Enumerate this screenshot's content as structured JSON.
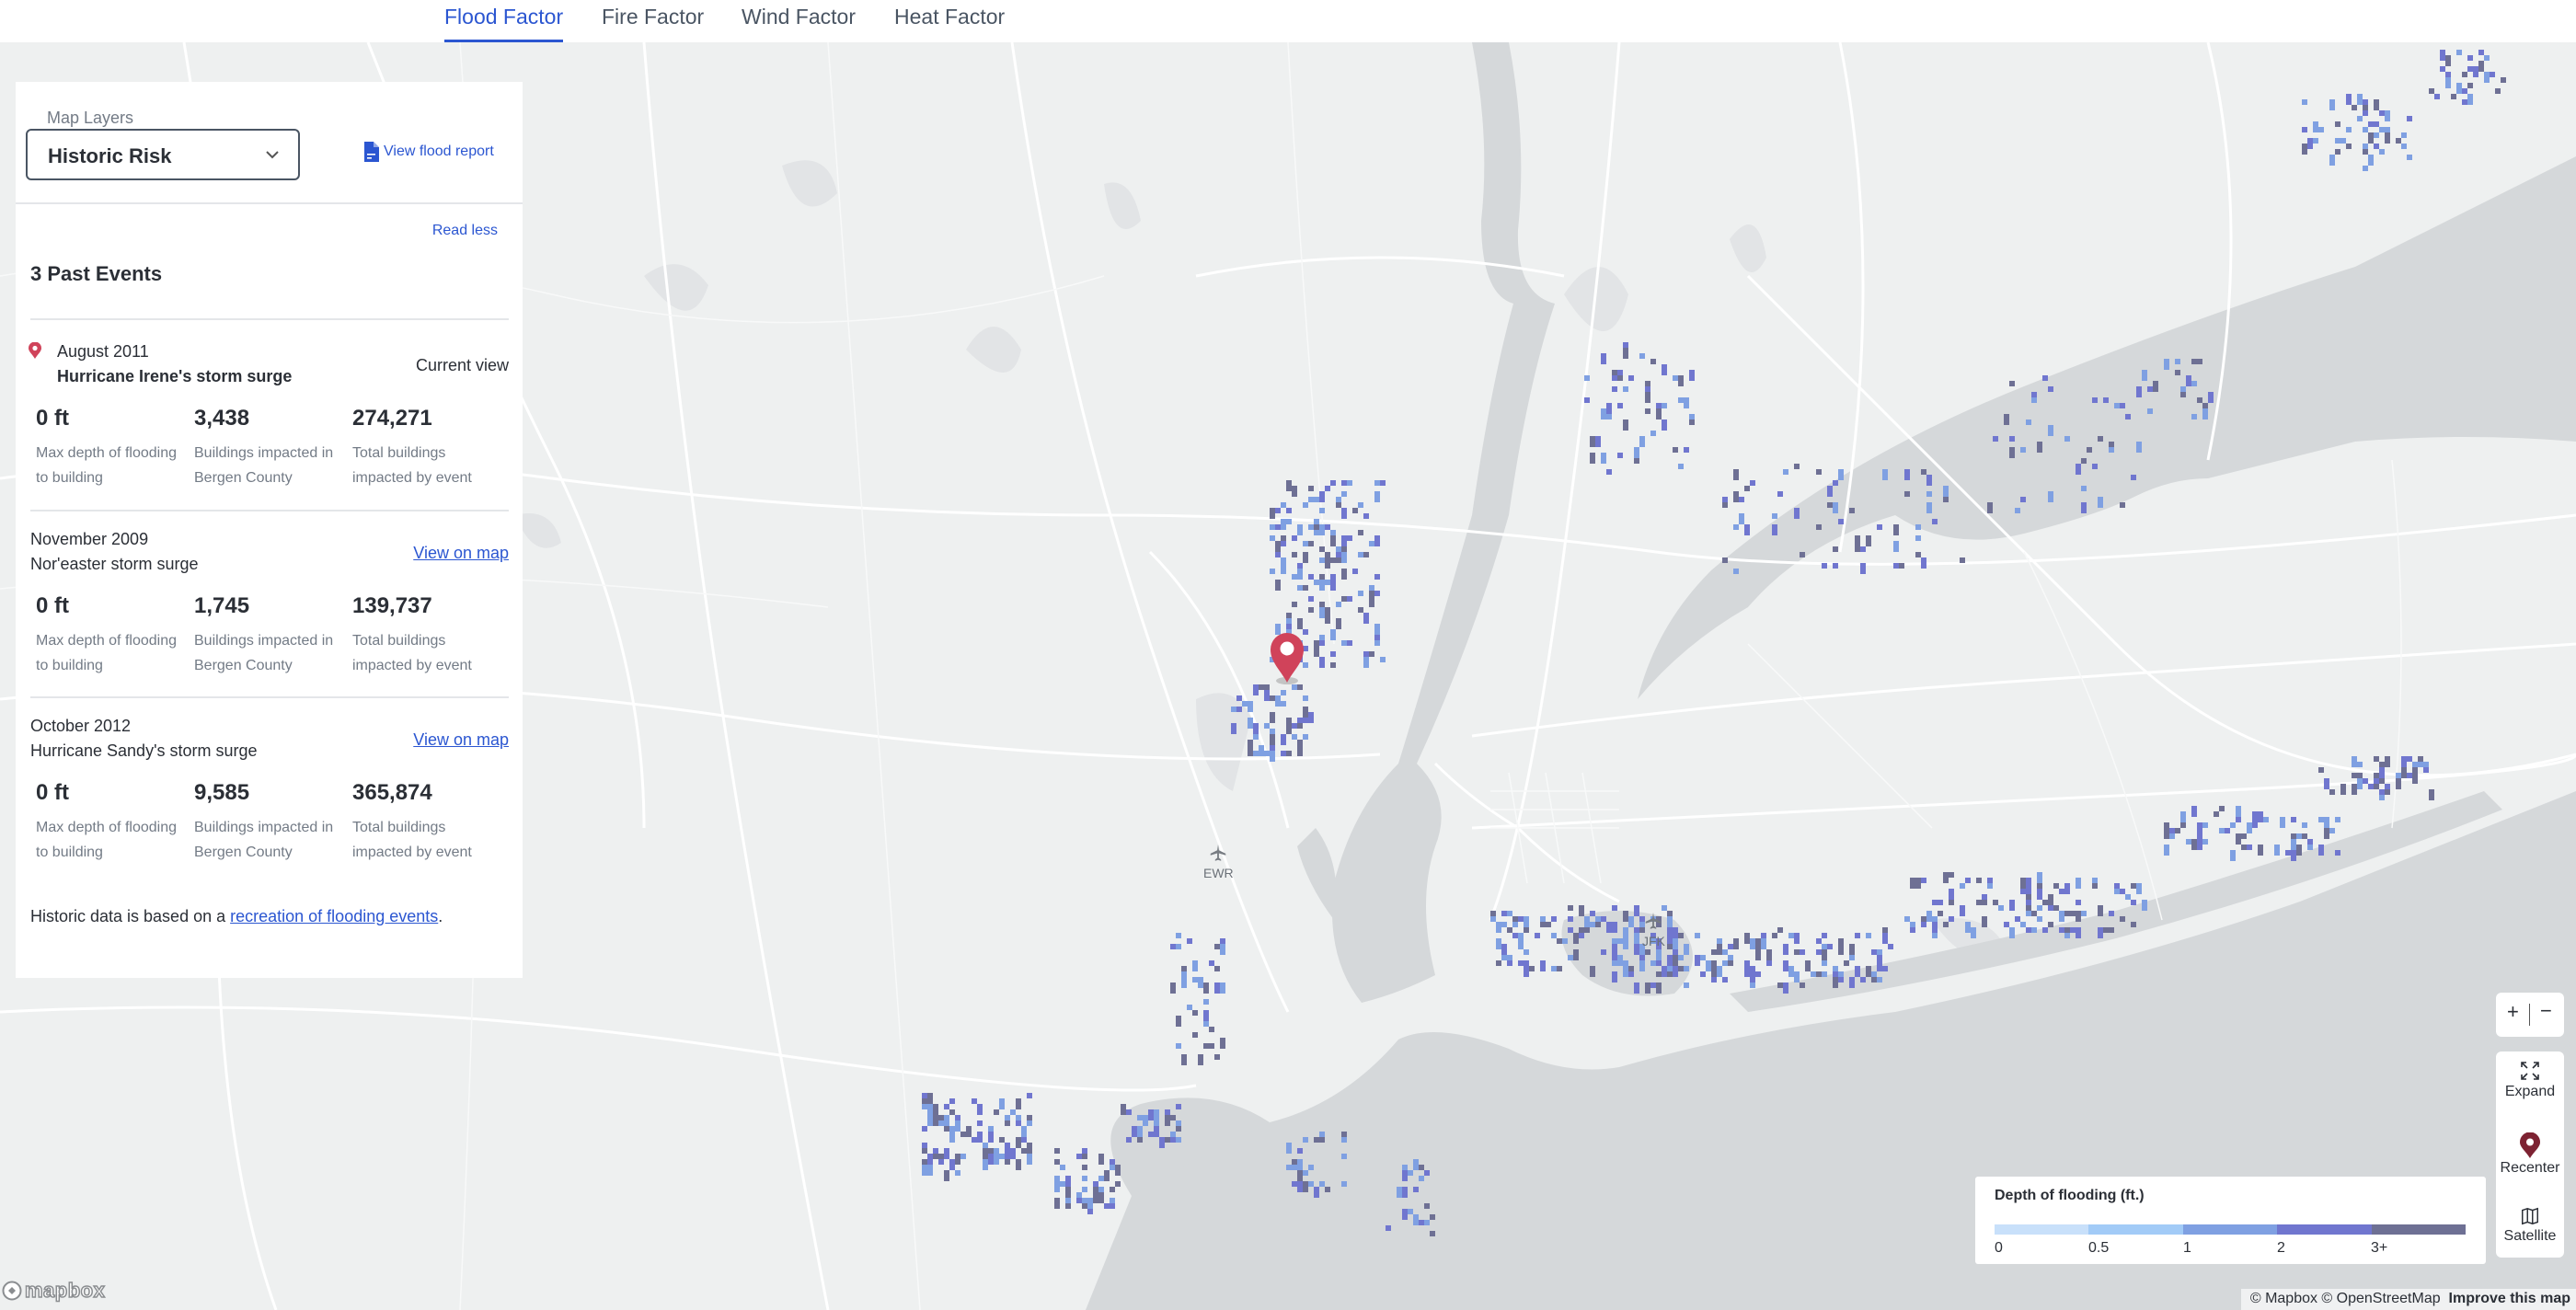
{
  "tabs": [
    {
      "label": "Flood Factor",
      "active": true
    },
    {
      "label": "Fire Factor",
      "active": false
    },
    {
      "label": "Wind Factor",
      "active": false
    },
    {
      "label": "Heat Factor",
      "active": false
    }
  ],
  "panel": {
    "map_layers_label": "Map Layers",
    "selected_layer": "Historic Risk",
    "view_report_label": "View flood report",
    "read_less_label": "Read less",
    "past_events_title": "3 Past Events",
    "stat_labels": {
      "max_depth": "Max depth of flooding to building",
      "county": "Buildings impacted in Bergen County",
      "total": "Total buildings impacted by event"
    },
    "events": [
      {
        "date": "August 2011",
        "name": "Hurricane Irene's storm surge",
        "action": "Current view",
        "current": true,
        "max_depth": "0 ft",
        "county_buildings": "3,438",
        "total_buildings": "274,271"
      },
      {
        "date": "November 2009",
        "name": "Nor'easter storm surge",
        "action": "View on map",
        "current": false,
        "max_depth": "0 ft",
        "county_buildings": "1,745",
        "total_buildings": "139,737"
      },
      {
        "date": "October 2012",
        "name": "Hurricane Sandy's storm surge",
        "action": "View on map",
        "current": false,
        "max_depth": "0 ft",
        "county_buildings": "9,585",
        "total_buildings": "365,874"
      }
    ],
    "footnote_prefix": "Historic data is based on a ",
    "footnote_link": "recreation of flooding events",
    "footnote_suffix": "."
  },
  "map": {
    "airports": [
      {
        "code": "EWR"
      },
      {
        "code": "JFK"
      }
    ],
    "land_color": "#eef0f0",
    "water_color": "#d5d8da",
    "road_color": "#ffffff",
    "pin_color": "#d0435a"
  },
  "controls": {
    "zoom_in": "+",
    "zoom_out": "−",
    "expand_label": "Expand",
    "recenter_label": "Recenter",
    "satellite_label": "Satellite",
    "recenter_icon_color": "#7d2232"
  },
  "legend": {
    "title": "Depth of flooding (ft.)",
    "ticks": [
      "0",
      "0.5",
      "1",
      "2",
      "3+"
    ],
    "colors": [
      "#c8e0fa",
      "#a2cbf7",
      "#7fa0e2",
      "#7076cf",
      "#6e7094"
    ]
  },
  "attribution": {
    "text": "© Mapbox © OpenStreetMap",
    "improve": "Improve this map",
    "logo": "mapbox"
  }
}
